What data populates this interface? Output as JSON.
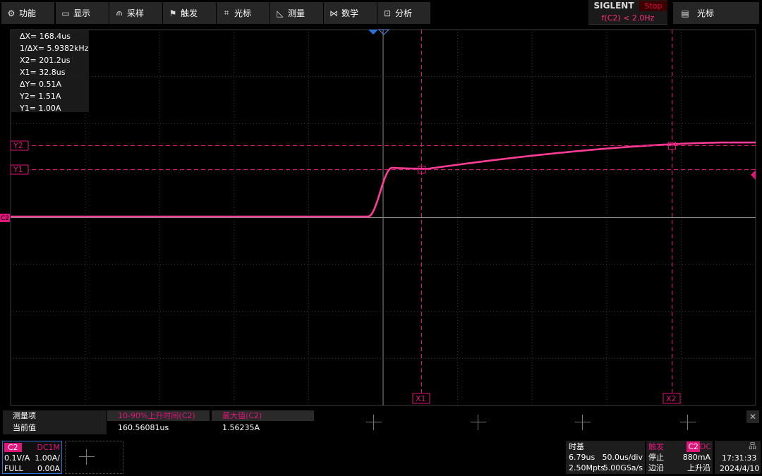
{
  "menu": {
    "items": [
      {
        "icon": "gear-icon",
        "glyph": "⚙",
        "label": "功能"
      },
      {
        "icon": "display-icon",
        "glyph": "▭",
        "label": "显示"
      },
      {
        "icon": "acquire-icon",
        "glyph": "⫙",
        "label": "采样"
      },
      {
        "icon": "trigger-icon",
        "glyph": "⚑",
        "label": "触发"
      },
      {
        "icon": "cursor-icon",
        "glyph": "⌗",
        "label": "光标"
      },
      {
        "icon": "measure-icon",
        "glyph": "◺",
        "label": "测量"
      },
      {
        "icon": "math-icon",
        "glyph": "⋈",
        "label": "数学"
      },
      {
        "icon": "analysis-icon",
        "glyph": "⊡",
        "label": "分析"
      }
    ],
    "brand": "SIGLENT",
    "run_state": "Stop",
    "frequency": "f(C2) < 2.0Hz",
    "cursor_menu_label": "光标"
  },
  "cursor_readout": {
    "dx": "ΔX= 168.4us",
    "inv_dx": "1/ΔX= 5.9382kHz",
    "x2": "X2= 201.2us",
    "x1": "X1= 32.8us",
    "dy": "ΔY= 0.51A",
    "y2": "Y2= 1.51A",
    "y1": "Y1= 1.00A"
  },
  "markers": {
    "y2": "Y2",
    "y1": "Y1",
    "x1": "X1",
    "x2": "X2",
    "channel": "C2"
  },
  "measure_panel": {
    "header_label": "测量项",
    "value_label": "当前值",
    "items": [
      {
        "name": "10-90%上升时间(C2)",
        "value": "160.56081us"
      },
      {
        "name": "最大值(C2)",
        "value": "1.56235A"
      }
    ]
  },
  "channel2": {
    "badge": "C2",
    "coupling": "DC1M",
    "scale": "0.1V/A",
    "amp_scale": "1.00A/",
    "bandwidth": "FULL",
    "offset": "0.00A"
  },
  "timebase": {
    "title": "时基",
    "delay": "6.79us",
    "scale": "50.0us/div",
    "memory": "2.50Mpts",
    "sample_rate": "5.00GSa/s"
  },
  "trigger": {
    "title": "触发",
    "source": "C2",
    "coupling": "DC",
    "state": "停止",
    "level": "880mA",
    "type": "边沿",
    "slope": "上升沿"
  },
  "clock": {
    "time": "17:31:33",
    "date": "2024/4/10"
  },
  "colors": {
    "trace": "#ff3d96",
    "cursor": "#e0147a",
    "measure_name": "#e0147a",
    "ch2_border": "#2b73d9",
    "trigger_marker": "#2b73d9"
  },
  "waveform": {
    "unit": "A",
    "start_level": 0.0,
    "edge_start_us": -10,
    "edge_end_us": 6,
    "overshoot_level": 1.0,
    "settle_level": 0.98,
    "final_level": 1.52
  }
}
